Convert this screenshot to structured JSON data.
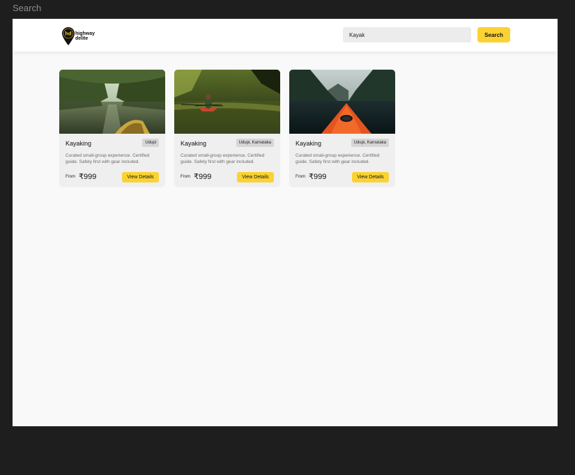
{
  "frame": {
    "label": "Search"
  },
  "header": {
    "logo": {
      "monogram": "hd",
      "line1": "highway",
      "line2": "delite"
    },
    "search": {
      "value": "Kayak",
      "button_label": "Search"
    }
  },
  "cards": [
    {
      "title": "Kayaking",
      "location": "Udupi",
      "description": "Curated small-group experience. Certified guide. Safety first with gear included.",
      "from_label": "From",
      "price": "₹999",
      "button_label": "View Details",
      "image": "mangrove-river-kayak-image"
    },
    {
      "title": "Kayaking",
      "location": "Udupi, Karnataka",
      "description": "Curated small-group experience. Certified guide. Safety first with gear included.",
      "from_label": "From",
      "price": "₹999",
      "button_label": "View Details",
      "image": "jungle-kayaker-image"
    },
    {
      "title": "Kayaking",
      "location": "Udupi, Karnataka",
      "description": "Curated small-group experience. Certified guide. Safety first with gear included.",
      "from_label": "From",
      "price": "₹999",
      "button_label": "View Details",
      "image": "fjord-red-kayak-image"
    }
  ],
  "colors": {
    "accent": "#fbd233",
    "page": "#f9f9f9",
    "card": "#efefef",
    "backdrop": "#1e1e1e"
  }
}
